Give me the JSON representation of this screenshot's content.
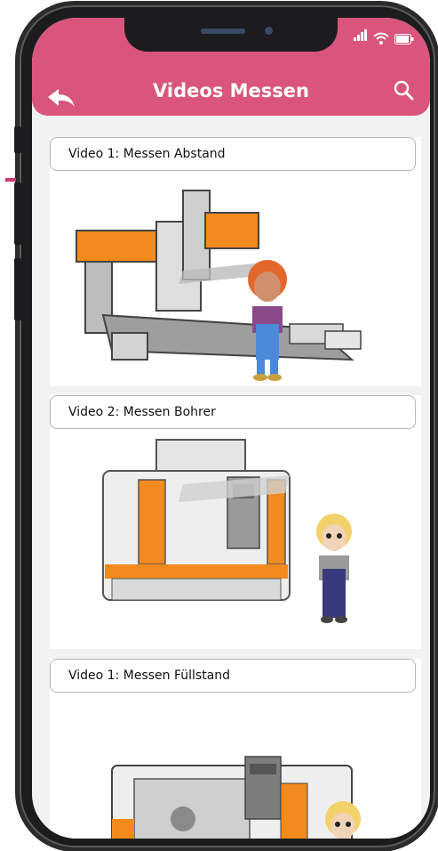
{
  "header": {
    "title": "Videos Messen",
    "color": "#d9557d"
  },
  "icons": {
    "back": "back-arrow-icon",
    "search": "search-icon",
    "signal": "signal-icon",
    "wifi": "wifi-icon",
    "battery": "battery-icon"
  },
  "videos": [
    {
      "label": "Video 1: Messen Abstand"
    },
    {
      "label": "Video 2: Messen Bohrer"
    },
    {
      "label": "Video 1: Messen Füllstand"
    }
  ]
}
